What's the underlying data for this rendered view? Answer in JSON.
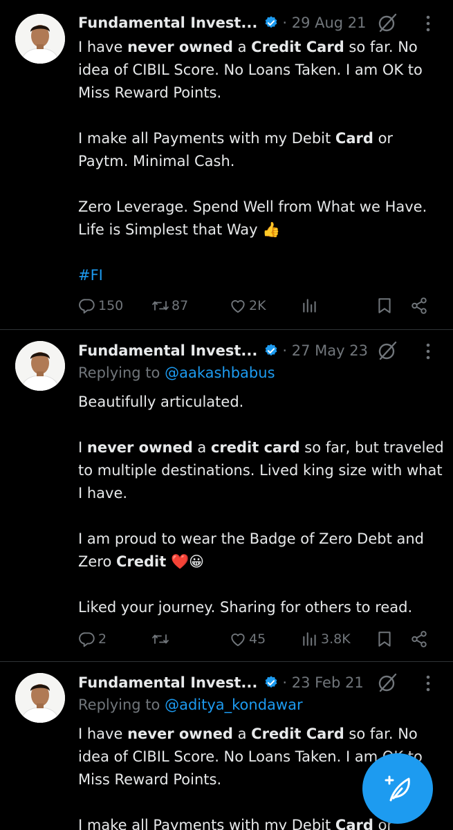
{
  "tweets": [
    {
      "author": "Fundamental Invest...",
      "date": "· 29 Aug 21",
      "reply_prefix": "",
      "reply_handle": "",
      "paragraphs": [
        [
          {
            "t": "I have "
          },
          {
            "t": "never owned",
            "b": true
          },
          {
            "t": " a "
          },
          {
            "t": "Credit Card",
            "b": true
          },
          {
            "t": " so far. No idea of CIBIL Score. No Loans Taken. I am OK to Miss Reward Points."
          }
        ],
        [
          {
            "t": "I make all Payments with my Debit "
          },
          {
            "t": "Card",
            "b": true
          },
          {
            "t": " or Paytm. Minimal Cash."
          }
        ],
        [
          {
            "t": "Zero Leverage. Spend Well from What we Have. Life is Simplest that Way 👍"
          }
        ],
        [
          {
            "t": "#FI",
            "h": true
          }
        ]
      ],
      "replies": "150",
      "reposts": "87",
      "likes": "2K",
      "views": ""
    },
    {
      "author": "Fundamental Invest...",
      "date": "· 27 May 23",
      "reply_prefix": "Replying to ",
      "reply_handle": "@aakashbabus",
      "paragraphs": [
        [
          {
            "t": "Beautifully articulated."
          }
        ],
        [
          {
            "t": "I "
          },
          {
            "t": "never owned",
            "b": true
          },
          {
            "t": " a "
          },
          {
            "t": "credit card",
            "b": true
          },
          {
            "t": " so far, but traveled to multiple destinations. Lived king size with what I have."
          }
        ],
        [
          {
            "t": "I am proud to wear the Badge of Zero Debt and Zero "
          },
          {
            "t": "Credit",
            "b": true
          },
          {
            "t": " ❤️😀"
          }
        ],
        [
          {
            "t": "Liked your journey. Sharing for others to read."
          }
        ]
      ],
      "replies": "2",
      "reposts": "",
      "likes": "45",
      "views": "3.8K"
    },
    {
      "author": "Fundamental Invest...",
      "date": "· 23 Feb 21",
      "reply_prefix": "Replying to ",
      "reply_handle": "@aditya_kondawar",
      "paragraphs": [
        [
          {
            "t": "I have "
          },
          {
            "t": "never owned",
            "b": true
          },
          {
            "t": " a "
          },
          {
            "t": "Credit Card",
            "b": true
          },
          {
            "t": " so far. No idea of CIBIL Score. No Loans Taken. I am OK to Miss Reward Points."
          }
        ],
        [
          {
            "t": "I make all Payments with my Debit "
          },
          {
            "t": "Card",
            "b": true
          },
          {
            "t": " or"
          }
        ]
      ],
      "replies": "",
      "reposts": "",
      "likes": "",
      "views": ""
    }
  ],
  "icons": {
    "verified": "verified-badge-icon",
    "grok": "grok-icon",
    "more": "more-options-icon",
    "reply": "reply-icon",
    "repost": "repost-icon",
    "like": "heart-icon",
    "views": "views-icon",
    "bookmark": "bookmark-icon",
    "share": "share-icon",
    "compose": "compose-post-icon"
  },
  "colors": {
    "background": "#000000",
    "text": "#e7e9ea",
    "muted": "#71767b",
    "accent": "#1d9bf0"
  }
}
